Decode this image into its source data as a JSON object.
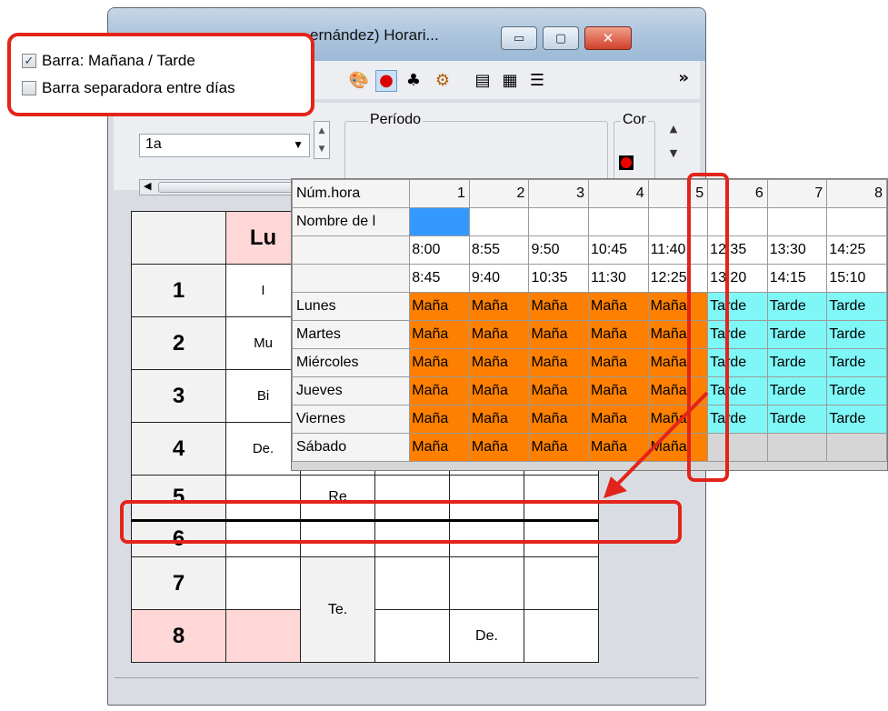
{
  "window": {
    "title": "ernández)  Horari...",
    "min_glyph": "▭",
    "max_glyph": "▢",
    "close_glyph": "✕"
  },
  "toolbar": {
    "icons": [
      "palette-icon",
      "pin-icon",
      "users-icon",
      "gear-icon",
      "document-icon",
      "export-icon",
      "layout-icon"
    ],
    "more_label": "»"
  },
  "controls": {
    "class_value": "1a",
    "periodo_label": "Período",
    "color_label": "Cor"
  },
  "checkboxes": [
    {
      "label": "Barra:  Mañana / Tarde",
      "checked": true,
      "mark": "✓"
    },
    {
      "label": "Barra separadora entre días",
      "checked": false,
      "mark": ""
    }
  ],
  "timetable": {
    "day_header": "Lu",
    "rows": [
      {
        "num": "1",
        "day": "I",
        "c2": "",
        "pink": false
      },
      {
        "num": "2",
        "day": "Mu",
        "c2": "",
        "pink": false
      },
      {
        "num": "3",
        "day": "Bi",
        "c2": "",
        "pink": false
      },
      {
        "num": "4",
        "day": "De.",
        "c2": "",
        "pink": false
      },
      {
        "num": "5",
        "day": "",
        "c2": "Re",
        "pink": false
      },
      {
        "num": "6",
        "day": "",
        "c2": "",
        "pink": false
      },
      {
        "num": "7",
        "day": "",
        "c2": "",
        "pink": false
      },
      {
        "num": "8",
        "day": "",
        "c2": "Te.",
        "pink": true
      }
    ],
    "extra_text": "De."
  },
  "hours_grid": {
    "header_label": "Núm.hora",
    "name_label": "Nombre de l",
    "hours": [
      "1",
      "2",
      "3",
      "4",
      "5",
      "6",
      "7",
      "8"
    ],
    "start_times": [
      "8:00",
      "8:55",
      "9:50",
      "10:45",
      "11:40",
      "12:35",
      "13:30",
      "14:25"
    ],
    "end_times": [
      "8:45",
      "9:40",
      "10:35",
      "11:30",
      "12:25",
      "13:20",
      "14:15",
      "15:10"
    ],
    "days": [
      {
        "name": "Lunes",
        "cells": [
          "Maña",
          "Maña",
          "Maña",
          "Maña",
          "Maña",
          "Tarde",
          "Tarde",
          "Tarde"
        ]
      },
      {
        "name": "Martes",
        "cells": [
          "Maña",
          "Maña",
          "Maña",
          "Maña",
          "Maña",
          "Tarde",
          "Tarde",
          "Tarde"
        ]
      },
      {
        "name": "Miércoles",
        "cells": [
          "Maña",
          "Maña",
          "Maña",
          "Maña",
          "Maña",
          "Tarde",
          "Tarde",
          "Tarde"
        ]
      },
      {
        "name": "Jueves",
        "cells": [
          "Maña",
          "Maña",
          "Maña",
          "Maña",
          "Maña",
          "Tarde",
          "Tarde",
          "Tarde"
        ]
      },
      {
        "name": "Viernes",
        "cells": [
          "Maña",
          "Maña",
          "Maña",
          "Maña",
          "Maña",
          "Tarde",
          "Tarde",
          "Tarde"
        ]
      },
      {
        "name": "Sábado",
        "cells": [
          "Maña",
          "Maña",
          "Maña",
          "Maña",
          "Maña",
          "",
          "",
          ""
        ]
      }
    ],
    "colors": {
      "morning": "#ff8000",
      "afternoon": "#7ff7f7",
      "selected": "#3399ff"
    }
  },
  "annotation_color": "#e3241b"
}
